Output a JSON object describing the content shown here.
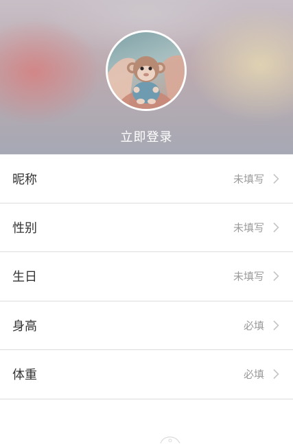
{
  "profile": {
    "login_label": "立即登录",
    "avatar": "monkey-plush-photo"
  },
  "fields": [
    {
      "key": "nickname",
      "label": "昵称",
      "value": "未填写",
      "icon": "chevron-right-icon"
    },
    {
      "key": "gender",
      "label": "性别",
      "value": "未填写",
      "icon": "chevron-right-icon"
    },
    {
      "key": "birthday",
      "label": "生日",
      "value": "未填写",
      "icon": "chevron-right-icon"
    },
    {
      "key": "height",
      "label": "身高",
      "value": "必填",
      "icon": "chevron-right-icon"
    },
    {
      "key": "weight",
      "label": "体重",
      "value": "必填",
      "icon": "chevron-right-icon"
    }
  ],
  "colors": {
    "label_text": "#333333",
    "value_text": "#9a9a9a",
    "divider": "#dcdcdc",
    "header_text": "#ffffff"
  }
}
